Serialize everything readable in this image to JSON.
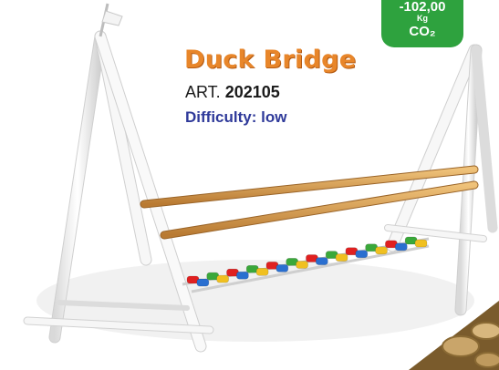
{
  "product": {
    "name": "Duck Bridge",
    "art_prefix": "ART.",
    "art_number": "202105",
    "difficulty": "Difficulty: low"
  },
  "badge": {
    "value": "-102,00",
    "unit": "Kg",
    "gas": "CO₂",
    "color": "#2ea23e"
  },
  "colors": {
    "title": "#e8862a",
    "difficulty": "#2f3a9a",
    "beam": "#d39a4f",
    "frame": "#f2f2f2",
    "stepping_blocks": [
      "#e02020",
      "#2a6fd0",
      "#3aa83a",
      "#f0c020"
    ]
  }
}
